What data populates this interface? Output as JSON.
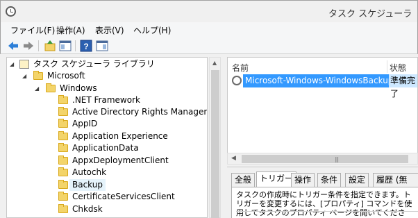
{
  "window": {
    "title": "タスク スケジューラ"
  },
  "menu": [
    {
      "label": "ファイル(F)"
    },
    {
      "label": "操作(A)"
    },
    {
      "label": "表示(V)"
    },
    {
      "label": "ヘルプ(H)"
    }
  ],
  "toolbar": {
    "icons": [
      "back-arrow-icon",
      "forward-arrow-icon",
      "up-folder-icon",
      "console-tree-icon",
      "help-icon",
      "show-action-pane-icon"
    ]
  },
  "tree": [
    {
      "label": "タスク スケジューラ ライブラリ",
      "level": 0,
      "expanded": true,
      "type": "library"
    },
    {
      "label": "Microsoft",
      "level": 1,
      "expanded": true,
      "type": "folder"
    },
    {
      "label": "Windows",
      "level": 2,
      "expanded": true,
      "type": "folder"
    },
    {
      "label": ".NET Framework",
      "level": 3,
      "type": "folder"
    },
    {
      "label": "Active Directory Rights Managemen",
      "level": 3,
      "type": "folder"
    },
    {
      "label": "AppID",
      "level": 3,
      "type": "folder"
    },
    {
      "label": "Application Experience",
      "level": 3,
      "type": "folder"
    },
    {
      "label": "ApplicationData",
      "level": 3,
      "type": "folder"
    },
    {
      "label": "AppxDeploymentClient",
      "level": 3,
      "type": "folder"
    },
    {
      "label": "Autochk",
      "level": 3,
      "type": "folder"
    },
    {
      "label": "Backup",
      "level": 3,
      "type": "folder",
      "selected": true
    },
    {
      "label": "CertificateServicesClient",
      "level": 3,
      "type": "folder"
    },
    {
      "label": "Chkdsk",
      "level": 3,
      "type": "folder"
    }
  ],
  "task_list": {
    "columns": [
      "名前",
      "状態"
    ],
    "rows": [
      {
        "name": "Microsoft-Windows-WindowsBackup",
        "status": "準備完了"
      }
    ]
  },
  "details": {
    "tabs": [
      "全般",
      "トリガー",
      "操作",
      "条件",
      "設定",
      "履歴 (無効)"
    ],
    "active_tab": "トリガー",
    "description": "タスクの作成時にトリガー条件を指定できます。トリガーを変更するには、[プロパティ] コマンドを使用してタスクのプロパティ ページを開いてください。"
  }
}
